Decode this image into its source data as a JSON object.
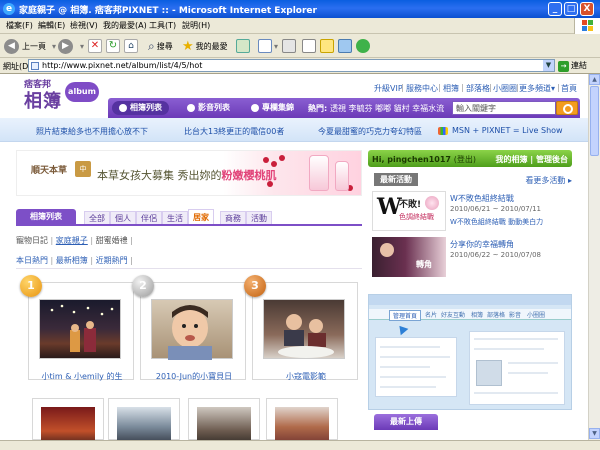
{
  "window": {
    "title": "家庭親子 @ 相簿. 痞客邦PIXNET :: - Microsoft Internet Explorer",
    "minimize": "_",
    "maximize": "□",
    "close": "X"
  },
  "menu": [
    "檔案(F)",
    "編輯(E)",
    "檢視(V)",
    "我的最愛(A)",
    "工具(T)",
    "說明(H)"
  ],
  "toolbar": {
    "back": "上一頁",
    "search": "搜尋",
    "favorites": "我的最愛"
  },
  "address": {
    "label": "網址(D)",
    "url": "http://www.pixnet.net/album/list/4/5/hot",
    "go": "連結"
  },
  "site": {
    "logo_top": "痞客邦",
    "logo_main": "相簿",
    "logo_album": "album",
    "top_links": [
      "升級VIP",
      "服務中心",
      "相簿",
      "部落格",
      "小圈圈",
      "更多頻道▾",
      "首頁"
    ],
    "nav_tabs": [
      "相簿列表",
      "影音列表",
      "專欄集錦"
    ],
    "hot_label": "熱門:",
    "hot_terms": "透視 李毓芬 嘟嘟 貓村 幸福水流",
    "search_placeholder": "輸入關鍵字"
  },
  "promo": [
    "照片結束給多也不用擔心放不下",
    "比台大13終更正的電信00者",
    "今夏最甜蜜的巧克力夸幻特區",
    "MSN + PIXNET = Live Show"
  ],
  "banner": {
    "brand": "順天本草",
    "brand_chip": "中",
    "copy_prefix": "本草女孩大募集 秀出妳的",
    "copy_highlight": "粉嫩櫻桃肌"
  },
  "categories": {
    "main": "相簿列表",
    "items": [
      "全部",
      "個人",
      "伴侶",
      "生活",
      "居家",
      "商務",
      "活動"
    ],
    "active_index": 4
  },
  "subnav": {
    "items": [
      "寵物日記",
      "家庭親子",
      "甜蜜婚禮"
    ],
    "active": "家庭親子"
  },
  "subnav2": [
    "本日熱門",
    "最新相簿",
    "近期熱門"
  ],
  "ranked_albums": [
    {
      "rank": "1",
      "caption": "小tim & 小emily 的生"
    },
    {
      "rank": "2",
      "caption": "2010-Jun的小寶貝日"
    },
    {
      "rank": "3",
      "caption": "小寇電影範"
    }
  ],
  "right": {
    "greeting": "Hi, pingchen1017",
    "logout": "(登出)",
    "my_album": "我的相簿",
    "manage": "管理後台",
    "section_latest": "最新活動",
    "more_events": "看更多活動 ▸",
    "events": [
      {
        "title": "W不敗色組終結戰",
        "date": "2010/06/21 ~ 2010/07/11",
        "sub": "W不敗色組終結戰 動動美白力"
      },
      {
        "title": "分享你的幸福轉角",
        "date": "2010/06/22 ~ 2010/07/08",
        "sub": "分享你的幸福轉角"
      }
    ],
    "event1_thumb_text": "不敗!",
    "event1_thumb_sub": "色調終結戰",
    "event2_thumb_text": "轉角",
    "demo_tabs": [
      "管理首頁",
      "名片",
      "好友互動",
      "相簿",
      "部落格",
      "影音",
      "小圈圈"
    ],
    "section_new": "最新上傳"
  },
  "colors": {
    "brand_purple": "#6a3fa0",
    "nav_purple": "#7d4fc7",
    "green": "#5aa92b",
    "link_blue": "#2d5fb5",
    "highlight_orange": "#e06a00",
    "badge_gold": "#f0a21a",
    "badge_silver": "#b8b8b8",
    "badge_bronze": "#d47c25"
  }
}
